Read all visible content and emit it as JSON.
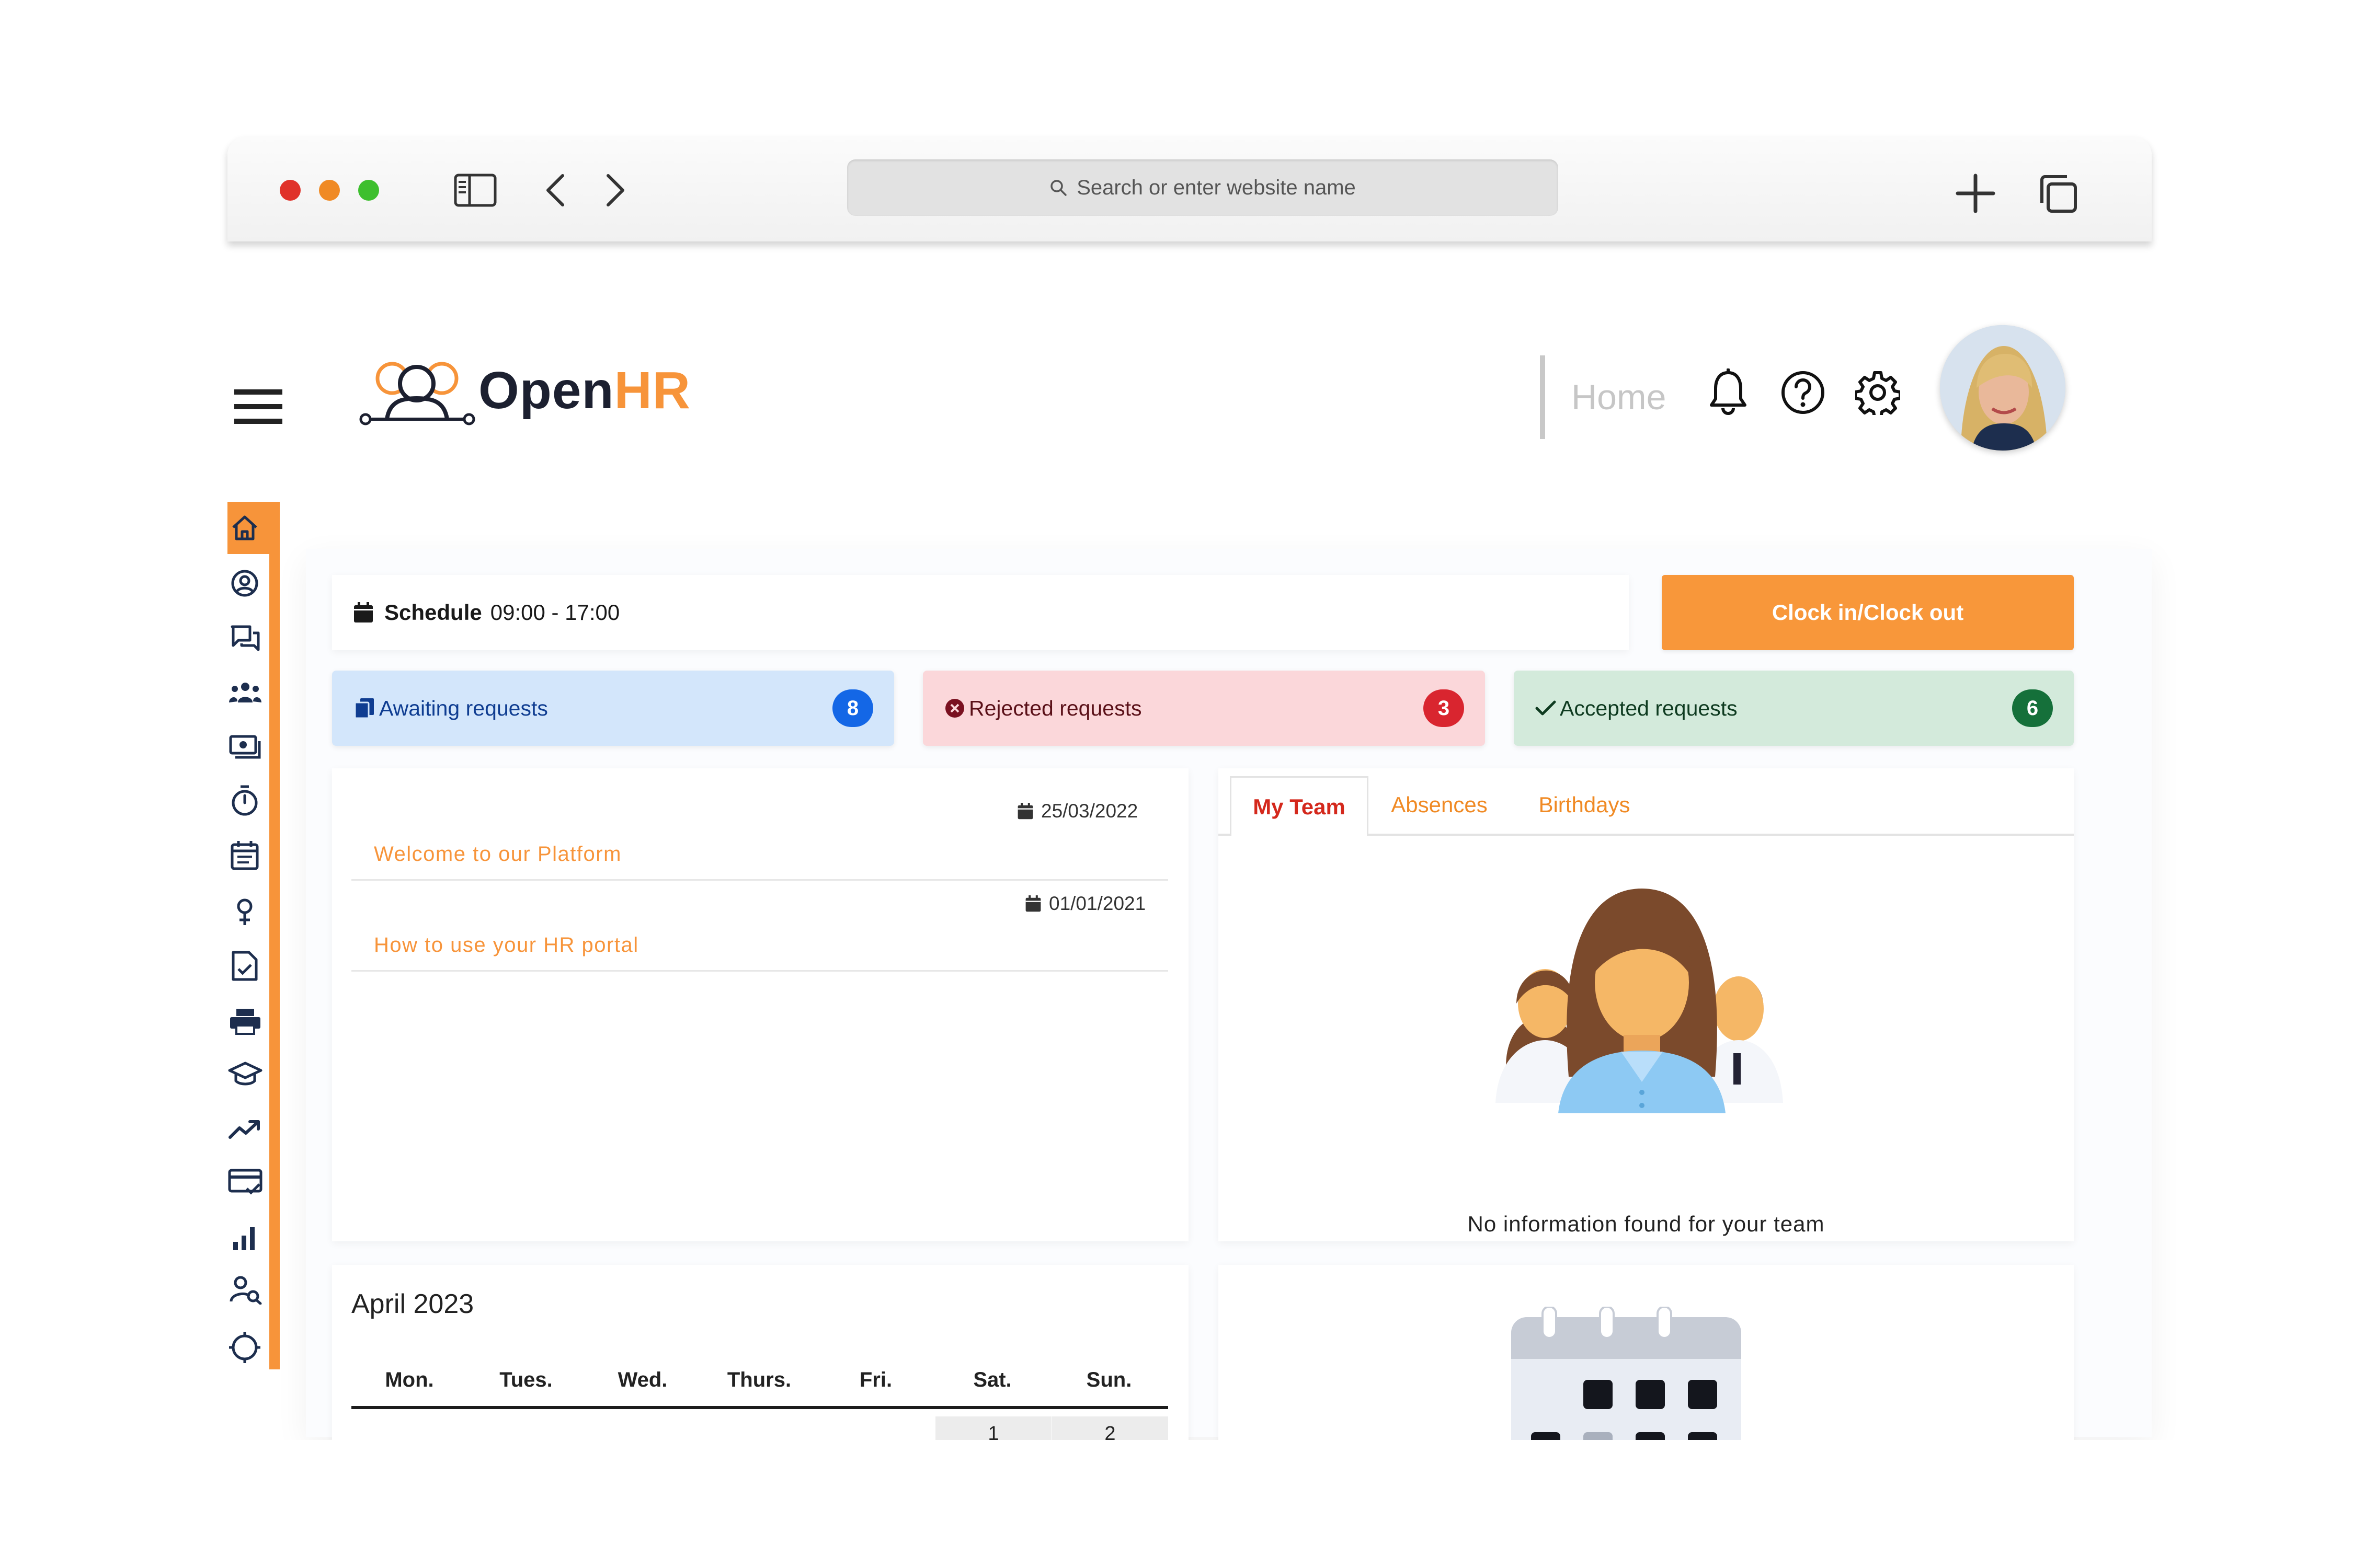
{
  "browser": {
    "search_placeholder": "Search or enter website name",
    "traffic_colors": [
      "#e0322a",
      "#f08a24",
      "#3dbf2e"
    ]
  },
  "header": {
    "logo_text_dark": "Open",
    "logo_text_accent": "HR",
    "page_title": "Home"
  },
  "colors": {
    "accent": "#f7943a",
    "awaiting_bg": "#d3e6fb",
    "awaiting_badge": "#1467e6",
    "rejected_bg": "#fbd7da",
    "rejected_badge": "#d9252f",
    "accepted_bg": "#d3eadb",
    "accepted_badge": "#15703a"
  },
  "sidebar": {
    "items": [
      {
        "icon": "home-icon"
      },
      {
        "icon": "user-circle-icon"
      },
      {
        "icon": "chat-icon"
      },
      {
        "icon": "team-icon"
      },
      {
        "icon": "payslip-icon"
      },
      {
        "icon": "stopwatch-icon"
      },
      {
        "icon": "calendar-icon"
      },
      {
        "icon": "location-pin-icon"
      },
      {
        "icon": "document-check-icon"
      },
      {
        "icon": "printer-icon"
      },
      {
        "icon": "graduation-cap-icon"
      },
      {
        "icon": "trending-icon"
      },
      {
        "icon": "card-check-icon"
      },
      {
        "icon": "bar-chart-icon"
      },
      {
        "icon": "user-search-icon"
      },
      {
        "icon": "target-icon"
      }
    ]
  },
  "schedule": {
    "label": "Schedule",
    "hours": "09:00 - 17:00"
  },
  "clock_button": "Clock in/Clock out",
  "requests": {
    "awaiting": {
      "label": "Awaiting requests",
      "count": "8"
    },
    "rejected": {
      "label": "Rejected requests",
      "count": "3"
    },
    "accepted": {
      "label": "Accepted requests",
      "count": "6"
    }
  },
  "news": [
    {
      "date": "25/03/2022",
      "title": "Welcome to our Platform"
    },
    {
      "date": "01/01/2021",
      "title": "How to use your HR portal"
    }
  ],
  "team": {
    "tabs": [
      "My Team",
      "Absences",
      "Birthdays"
    ],
    "empty_message": "No information found for your team"
  },
  "calendar": {
    "month": "April 2023",
    "days": [
      "Mon.",
      "Tues.",
      "Wed.",
      "Thurs.",
      "Fri.",
      "Sat.",
      "Sun."
    ],
    "first_dates": [
      "1",
      "2"
    ]
  }
}
